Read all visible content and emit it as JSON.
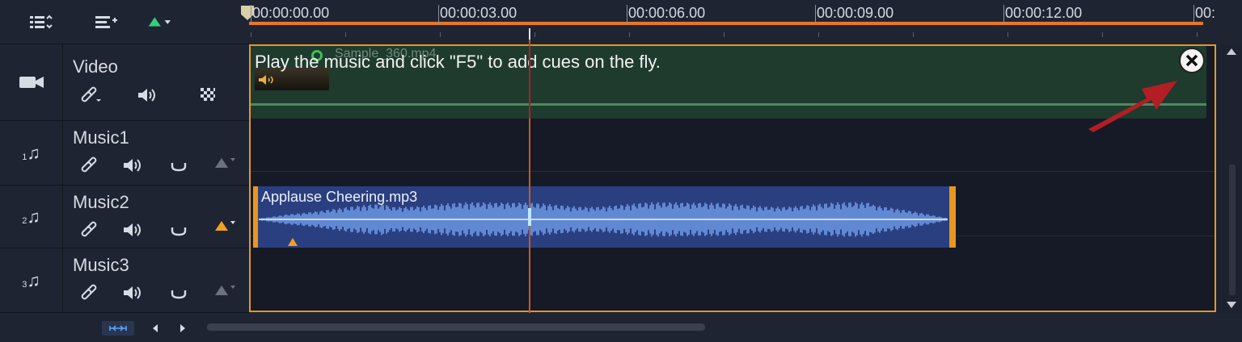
{
  "toolbar": {
    "icons": [
      "track-manager-icon",
      "add-track-icon",
      "ripple-editing-icon"
    ]
  },
  "ruler": {
    "ticks": [
      "00:00:00.00",
      "00:00:03.00",
      "00:00:06.00",
      "00:00:09.00",
      "00:00:12.00",
      "00:"
    ]
  },
  "tracks": [
    {
      "name": "Video",
      "index": ""
    },
    {
      "name": "Music1",
      "index": "1"
    },
    {
      "name": "Music2",
      "index": "2"
    },
    {
      "name": "Music3",
      "index": "3"
    }
  ],
  "video_clip": {
    "file": "Sample_360.mp4"
  },
  "hint": {
    "text": "Play the music and click \"F5\" to add cues on the fly."
  },
  "audio_clip": {
    "file": "Applause Cheering.mp3"
  },
  "colors": {
    "accent": "#e8971e",
    "video_clip": "#1f3b2e",
    "audio_clip": "#2a3f80",
    "waveform": "#6f9ae8",
    "arrow": "#b21e24"
  }
}
